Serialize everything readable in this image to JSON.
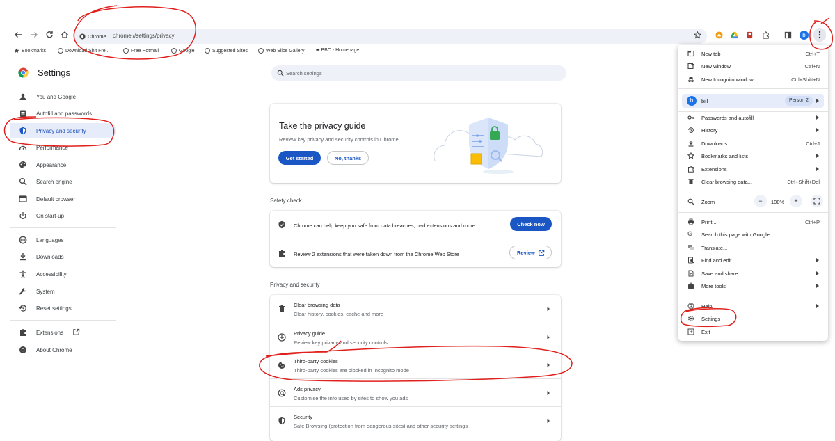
{
  "browser": {
    "chip_label": "Chrome",
    "url": "chrome://settings/privacy",
    "avatar_letter": "b"
  },
  "bookmarks": [
    {
      "label": "Bookmarks",
      "icon": "star-icon"
    },
    {
      "label": "Download Shit Fre...",
      "icon": "globe-icon"
    },
    {
      "label": "Free Hotmail",
      "icon": "globe-icon"
    },
    {
      "label": "Google",
      "icon": "globe-icon"
    },
    {
      "label": "Suggested Sites",
      "icon": "globe-icon"
    },
    {
      "label": "Web Slice Gallery",
      "icon": "globe-icon"
    },
    {
      "label": "BBC - Homepage",
      "icon": "bbc-icon"
    }
  ],
  "sidebar": {
    "title": "Settings",
    "items": [
      {
        "label": "You and Google",
        "icon": "person-icon"
      },
      {
        "label": "Autofill and passwords",
        "icon": "clipboard-icon"
      },
      {
        "label": "Privacy and security",
        "icon": "shield-icon",
        "active": true
      },
      {
        "label": "Performance",
        "icon": "speedometer-icon"
      },
      {
        "label": "Appearance",
        "icon": "palette-icon"
      },
      {
        "label": "Search engine",
        "icon": "search-icon"
      },
      {
        "label": "Default browser",
        "icon": "browser-icon"
      },
      {
        "label": "On start-up",
        "icon": "power-icon"
      },
      {
        "label": "Languages",
        "icon": "globe-icon"
      },
      {
        "label": "Downloads",
        "icon": "download-icon"
      },
      {
        "label": "Accessibility",
        "icon": "accessibility-icon"
      },
      {
        "label": "System",
        "icon": "wrench-icon"
      },
      {
        "label": "Reset settings",
        "icon": "history-icon"
      },
      {
        "label": "Extensions",
        "icon": "puzzle-icon"
      },
      {
        "label": "About Chrome",
        "icon": "chrome-icon"
      }
    ]
  },
  "search": {
    "placeholder": "Search settings"
  },
  "privacy_guide_card": {
    "title": "Take the privacy guide",
    "subtitle": "Review key privacy and security controls in Chrome",
    "primary": "Get started",
    "secondary": "No, thanks"
  },
  "safety_check": {
    "heading": "Safety check",
    "rows": [
      {
        "text": "Chrome can help keep you safe from data breaches, bad extensions and more",
        "button": "Check now",
        "icon": "shield-check-icon"
      },
      {
        "text": "Review 2 extensions that were taken down from the Chrome Web Store",
        "button": "Review",
        "icon": "puzzle-icon"
      }
    ]
  },
  "privacy_security": {
    "heading": "Privacy and security",
    "rows": [
      {
        "title": "Clear browsing data",
        "sub": "Clear history, cookies, cache and more",
        "icon": "trash-icon"
      },
      {
        "title": "Privacy guide",
        "sub": "Review key privacy and security controls",
        "icon": "compass-icon"
      },
      {
        "title": "Third-party cookies",
        "sub": "Third-party cookies are blocked in Incognito mode",
        "icon": "cookie-icon"
      },
      {
        "title": "Ads privacy",
        "sub": "Customise the info used by sites to show you ads",
        "icon": "ads-icon"
      },
      {
        "title": "Security",
        "sub": "Safe Browsing (protection from dangerous sites) and other security settings",
        "icon": "shield-icon"
      }
    ]
  },
  "menu": {
    "new_tab": {
      "label": "New tab",
      "shortcut": "Ctrl+T"
    },
    "new_window": {
      "label": "New window",
      "shortcut": "Ctrl+N"
    },
    "incognito": {
      "label": "New Incognito window",
      "shortcut": "Ctrl+Shift+N"
    },
    "profile": {
      "name": "bill",
      "badge": "Person 2",
      "letter": "b"
    },
    "passwords": {
      "label": "Passwords and autofill"
    },
    "history": {
      "label": "History"
    },
    "downloads": {
      "label": "Downloads",
      "shortcut": "Ctrl+J"
    },
    "bookmarks": {
      "label": "Bookmarks and lists"
    },
    "extensions": {
      "label": "Extensions"
    },
    "clear": {
      "label": "Clear browsing data...",
      "shortcut": "Ctrl+Shift+Del"
    },
    "zoom": {
      "label": "Zoom",
      "minus": "−",
      "value": "100%",
      "plus": "+"
    },
    "print": {
      "label": "Print...",
      "shortcut": "Ctrl+P"
    },
    "search_page": {
      "label": "Search this page with Google..."
    },
    "translate": {
      "label": "Translate..."
    },
    "find": {
      "label": "Find and edit"
    },
    "save": {
      "label": "Save and share"
    },
    "more_tools": {
      "label": "More tools"
    },
    "help": {
      "label": "Help"
    },
    "settings": {
      "label": "Settings"
    },
    "exit": {
      "label": "Exit"
    }
  },
  "colors": {
    "accent": "#1a56c4",
    "annotation": "#e0201c",
    "active_bg": "#e6ecf9"
  }
}
